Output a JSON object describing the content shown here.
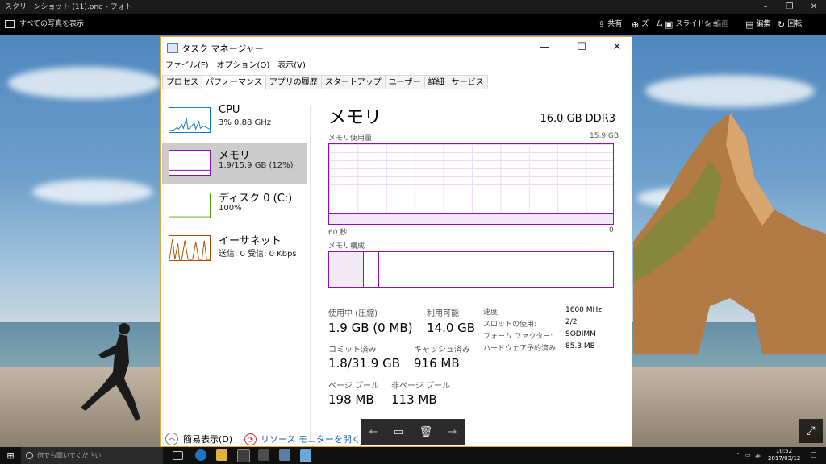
{
  "photos": {
    "window_title": "スクリーンショット (11).png - フォト",
    "all_photos": "すべての写真を表示",
    "toolbar": [
      {
        "name": "share",
        "label": "共有",
        "glyph": "⇪",
        "dim": false
      },
      {
        "name": "zoom",
        "label": "ズーム",
        "glyph": "⊕",
        "dim": false
      },
      {
        "name": "slideshow",
        "label": "スライドショー",
        "glyph": "▣",
        "dim": false
      },
      {
        "name": "draw",
        "label": "描画",
        "glyph": "✎",
        "dim": true
      },
      {
        "name": "edit",
        "label": "編集",
        "glyph": "▤",
        "dim": false
      },
      {
        "name": "rotate",
        "label": "回転",
        "glyph": "↻",
        "dim": false
      }
    ],
    "expand_glyph": "⤢"
  },
  "tm": {
    "title": "タスク マネージャー",
    "menu": [
      "ファイル(F)",
      "オプション(O)",
      "表示(V)"
    ],
    "tabs": [
      "プロセス",
      "パフォーマンス",
      "アプリの履歴",
      "スタートアップ",
      "ユーザー",
      "詳細",
      "サービス"
    ],
    "active_tab": 1,
    "sidebar": [
      {
        "name": "CPU",
        "value": "3%  0.88 GHz",
        "color": "#117dbb",
        "selected": false
      },
      {
        "name": "メモリ",
        "value": "1.9/15.9 GB (12%)",
        "color": "#8b12ae",
        "selected": true
      },
      {
        "name": "ディスク 0 (C:)",
        "value": "100%",
        "color": "#4da60c",
        "selected": false
      },
      {
        "name": "イーサネット",
        "value": "送信: 0 受信: 0 Kbps",
        "color": "#a74f01",
        "selected": false
      }
    ],
    "main": {
      "title": "メモリ",
      "spec": "16.0 GB DDR3",
      "usage_label": "メモリ使用量",
      "usage_max": "15.9 GB",
      "time_left": "60 秒",
      "time_right": "0",
      "composition_label": "メモリ構成",
      "stats": {
        "in_use_label": "使用中 (圧縮)",
        "in_use": "1.9 GB (0 MB)",
        "available_label": "利用可能",
        "available": "14.0 GB",
        "committed_label": "コミット済み",
        "committed": "1.8/31.9 GB",
        "cached_label": "キャッシュ済み",
        "cached": "916 MB",
        "paged_label": "ページ プール",
        "paged": "198 MB",
        "nonpaged_label": "非ページ プール",
        "nonpaged": "113 MB"
      },
      "props": [
        {
          "label": "速度:",
          "value": "1600 MHz"
        },
        {
          "label": "スロットの使用:",
          "value": "2/2"
        },
        {
          "label": "フォーム ファクター:",
          "value": "SODIMM"
        },
        {
          "label": "ハードウェア予約済み:",
          "value": "85.3 MB"
        }
      ]
    },
    "fewer_details": "簡易表示(D)",
    "resource_monitor": "リソース モニターを開く"
  },
  "nav": {
    "prev": "←",
    "info": "▭",
    "delete": "🗑",
    "next": "→"
  },
  "taskbar": {
    "search_placeholder": "何でも聞いてください",
    "time": "10:52",
    "date": "2017/03/12"
  }
}
